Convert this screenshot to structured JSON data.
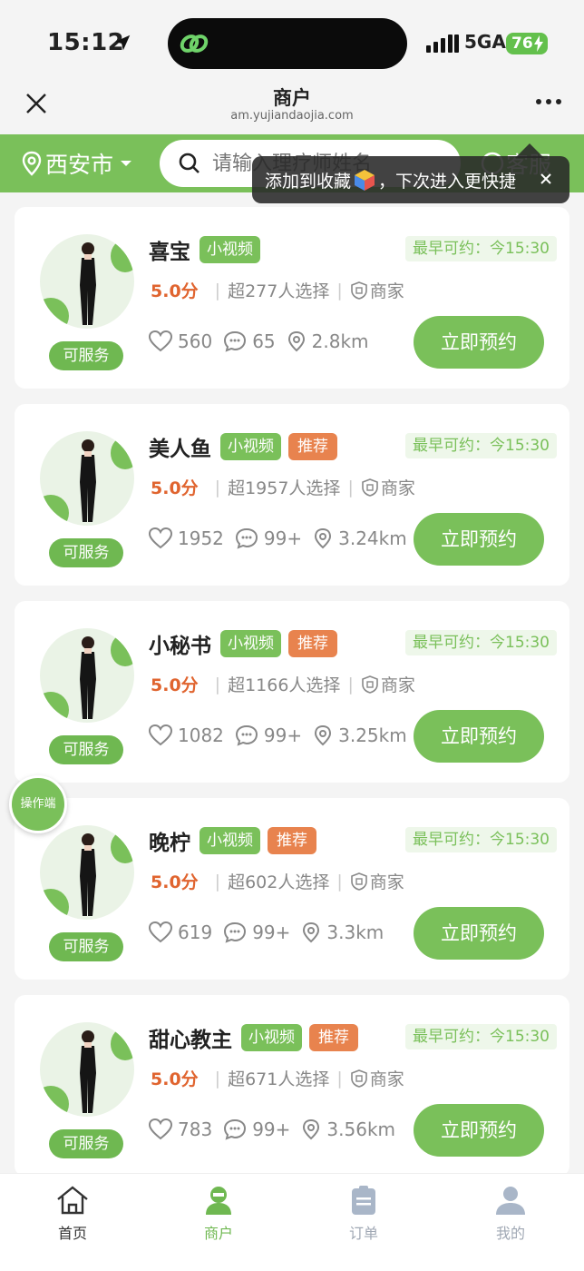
{
  "status_bar": {
    "time": "15:12",
    "network": "5GA",
    "battery": "76"
  },
  "nav": {
    "title": "商户",
    "url": "am.yujiandaojia.com"
  },
  "search": {
    "city": "西安市",
    "placeholder": "请输入理疗师姓名",
    "service_label": "客服"
  },
  "toast": {
    "text_before": "添加到收藏",
    "text_after": "，下次进入更快捷"
  },
  "cards": [
    {
      "name": "喜宝",
      "video": "小视频",
      "recommend": "",
      "earliest": "最早可约：今15:30",
      "score": "5.0分",
      "chosen": "超277人选择",
      "merchant": "商家",
      "likes": "560",
      "comments": "65",
      "distance": "2.8km",
      "status": "可服务",
      "button": "立即预约"
    },
    {
      "name": "美人鱼",
      "video": "小视频",
      "recommend": "推荐",
      "earliest": "最早可约：今15:30",
      "score": "5.0分",
      "chosen": "超1957人选择",
      "merchant": "商家",
      "likes": "1952",
      "comments": "99+",
      "distance": "3.24km",
      "status": "可服务",
      "button": "立即预约"
    },
    {
      "name": "小秘书",
      "video": "小视频",
      "recommend": "推荐",
      "earliest": "最早可约：今15:30",
      "score": "5.0分",
      "chosen": "超1166人选择",
      "merchant": "商家",
      "likes": "1082",
      "comments": "99+",
      "distance": "3.25km",
      "status": "可服务",
      "button": "立即预约"
    },
    {
      "name": "晚柠",
      "video": "小视频",
      "recommend": "推荐",
      "earliest": "最早可约：今15:30",
      "score": "5.0分",
      "chosen": "超602人选择",
      "merchant": "商家",
      "likes": "619",
      "comments": "99+",
      "distance": "3.3km",
      "status": "可服务",
      "button": "立即预约"
    },
    {
      "name": "甜心教主",
      "video": "小视频",
      "recommend": "推荐",
      "earliest": "最早可约：今15:30",
      "score": "5.0分",
      "chosen": "超671人选择",
      "merchant": "商家",
      "likes": "783",
      "comments": "99+",
      "distance": "3.56km",
      "status": "可服务",
      "button": "立即预约"
    }
  ],
  "float_button": "操作端",
  "tabs": [
    {
      "label": "首页",
      "icon": "home-icon",
      "active": false
    },
    {
      "label": "商户",
      "icon": "merchant-icon",
      "active": true
    },
    {
      "label": "订单",
      "icon": "order-icon",
      "active": false
    },
    {
      "label": "我的",
      "icon": "user-icon",
      "active": false
    }
  ],
  "colors": {
    "accent": "#7ac05a",
    "recommend": "#e8834e",
    "score": "#e0642f"
  }
}
